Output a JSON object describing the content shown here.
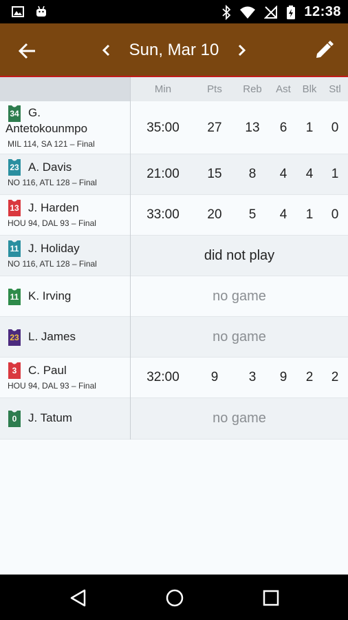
{
  "status_bar": {
    "time": "12:38"
  },
  "app_bar": {
    "date": "Sun, Mar 10"
  },
  "columns": [
    "Min",
    "Pts",
    "Reb",
    "Ast",
    "Blk",
    "Stl"
  ],
  "players": [
    {
      "jersey": "34",
      "jersey_color": "#2e7d4f",
      "name_line1": "G.",
      "name_line2": "Antetokounmpo",
      "game": "MIL 114, SA 121 – Final",
      "stats": [
        "35:00",
        "27",
        "13",
        "6",
        "1",
        "0"
      ]
    },
    {
      "jersey": "23",
      "jersey_color": "#2a8fa0",
      "name": "A. Davis",
      "game": "NO 116, ATL 128 – Final",
      "stats": [
        "21:00",
        "15",
        "8",
        "4",
        "4",
        "1"
      ]
    },
    {
      "jersey": "13",
      "jersey_color": "#d9383f",
      "name": "J. Harden",
      "game": "HOU 94, DAL 93 – Final",
      "stats": [
        "33:00",
        "20",
        "5",
        "4",
        "1",
        "0"
      ]
    },
    {
      "jersey": "11",
      "jersey_color": "#2a8fa0",
      "name": "J. Holiday",
      "game": "NO 116, ATL 128 – Final",
      "status": "did not play"
    },
    {
      "jersey": "11",
      "jersey_color": "#2e8b4a",
      "name": "K. Irving",
      "status": "no game"
    },
    {
      "jersey": "23",
      "jersey_color": "#4b2a7e",
      "name": "L. James",
      "status": "no game"
    },
    {
      "jersey": "3",
      "jersey_color": "#d9383f",
      "name": "C. Paul",
      "game": "HOU 94, DAL 93 – Final",
      "stats": [
        "32:00",
        "9",
        "3",
        "9",
        "2",
        "2"
      ]
    },
    {
      "jersey": "0",
      "jersey_color": "#2e7d4f",
      "name": "J. Tatum",
      "status": "no game"
    }
  ],
  "icons": {
    "back": "arrow-left-icon",
    "prev": "chevron-left-icon",
    "next": "chevron-right-icon",
    "edit": "pencil-icon"
  }
}
